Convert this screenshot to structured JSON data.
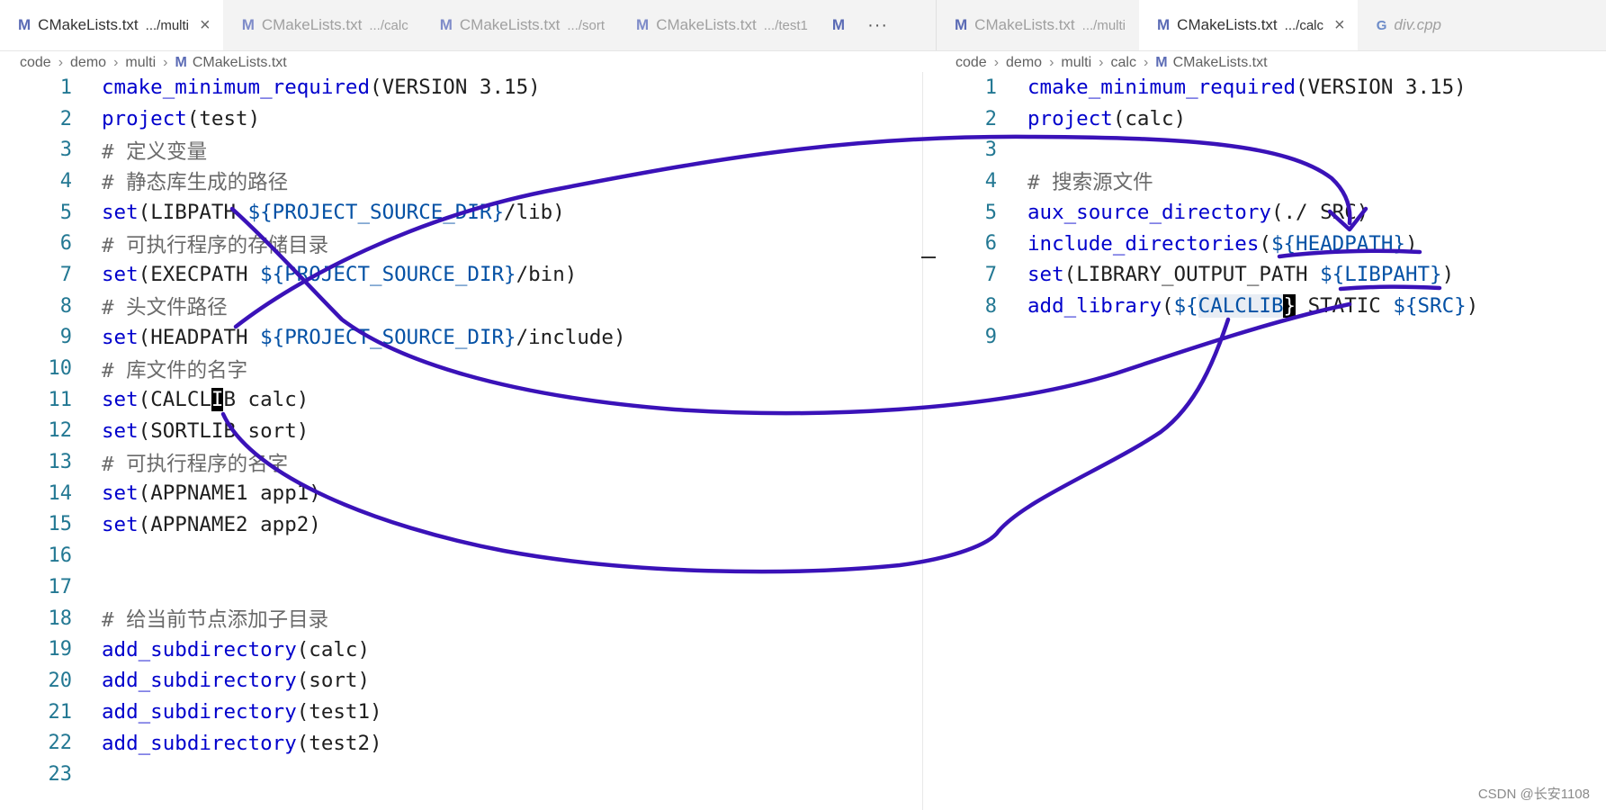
{
  "left_pane": {
    "tabs": [
      {
        "name": "CMakeLists.txt",
        "dir": ".../multi",
        "close": "×"
      },
      {
        "name": "CMakeLists.txt",
        "dir": ".../calc"
      },
      {
        "name": "CMakeLists.txt",
        "dir": ".../sort"
      },
      {
        "name": "CMakeLists.txt",
        "dir": ".../test1"
      }
    ],
    "overflow_label": "···",
    "tab_icon": "M",
    "breadcrumb": [
      "code",
      "demo",
      "multi",
      "CMakeLists.txt"
    ],
    "lines": [
      {
        "n": "1",
        "t": "cmake_minimum_required(VERSION 3.15)"
      },
      {
        "n": "2",
        "t": "project(test)"
      },
      {
        "n": "3",
        "t": "# 定义变量"
      },
      {
        "n": "4",
        "t": "# 静态库生成的路径"
      },
      {
        "n": "5",
        "t": "set(LIBPATH ${PROJECT_SOURCE_DIR}/lib)"
      },
      {
        "n": "6",
        "t": "# 可执行程序的存储目录"
      },
      {
        "n": "7",
        "t": "set(EXECPATH ${PROJECT_SOURCE_DIR}/bin)"
      },
      {
        "n": "8",
        "t": "# 头文件路径"
      },
      {
        "n": "9",
        "t": "set(HEADPATH ${PROJECT_SOURCE_DIR}/include)"
      },
      {
        "n": "10",
        "t": "# 库文件的名字"
      },
      {
        "n": "11",
        "t": "set(CALCLIB calc)"
      },
      {
        "n": "12",
        "t": "set(SORTLIB sort)"
      },
      {
        "n": "13",
        "t": "# 可执行程序的名字"
      },
      {
        "n": "14",
        "t": "set(APPNAME1 app1)"
      },
      {
        "n": "15",
        "t": "set(APPNAME2 app2)"
      },
      {
        "n": "16",
        "t": ""
      },
      {
        "n": "17",
        "t": ""
      },
      {
        "n": "18",
        "t": "# 给当前节点添加子目录"
      },
      {
        "n": "19",
        "t": "add_subdirectory(calc)"
      },
      {
        "n": "20",
        "t": "add_subdirectory(sort)"
      },
      {
        "n": "21",
        "t": "add_subdirectory(test1)"
      },
      {
        "n": "22",
        "t": "add_subdirectory(test2)"
      },
      {
        "n": "23",
        "t": ""
      }
    ]
  },
  "right_pane": {
    "tabs": [
      {
        "name": "CMakeLists.txt",
        "dir": ".../multi"
      },
      {
        "name": "CMakeLists.txt",
        "dir": ".../calc",
        "close": "×"
      },
      {
        "name": "div.cpp",
        "dir": ""
      }
    ],
    "cpp_icon": "G",
    "breadcrumb": [
      "code",
      "demo",
      "multi",
      "calc",
      "CMakeLists.txt"
    ],
    "lines": [
      {
        "n": "1",
        "t": "cmake_minimum_required(VERSION 3.15)"
      },
      {
        "n": "2",
        "t": "project(calc)"
      },
      {
        "n": "3",
        "t": ""
      },
      {
        "n": "4",
        "t": "# 搜索源文件"
      },
      {
        "n": "5",
        "t": "aux_source_directory(./ SRC)"
      },
      {
        "n": "6",
        "t": "include_directories(${HEADPATH})"
      },
      {
        "n": "7",
        "t": "set(LIBRARY_OUTPUT_PATH ${LIBPAHT})"
      },
      {
        "n": "8",
        "t": "add_library(${CALCLIB} STATIC ${SRC})"
      },
      {
        "n": "9",
        "t": ""
      }
    ]
  },
  "watermark": "CSDN @长安1108",
  "colors": {
    "annotation_ink": "#3a12b8",
    "keyword": "#0000cc",
    "variable": "#0451a5",
    "line_number": "#237893"
  }
}
